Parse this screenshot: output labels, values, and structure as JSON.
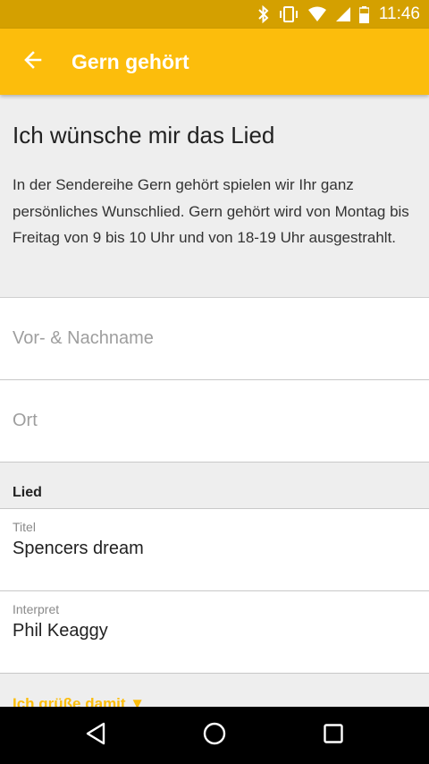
{
  "status_bar": {
    "time": "11:46",
    "icons": [
      "bluetooth-icon",
      "vibrate-icon",
      "wifi-icon",
      "signal-icon",
      "battery-icon"
    ]
  },
  "app_bar": {
    "title": "Gern gehört",
    "back_icon": "arrow-back-icon",
    "color": "#fcbd0c"
  },
  "intro": {
    "heading": "Ich wünsche mir das Lied",
    "description": "In der Sendereihe Gern gehört spielen wir Ihr ganz persönliches Wunschlied. Gern gehört wird von Montag bis Freitag von 9 bis 10 Uhr und von 18-19 Uhr ausgestrahlt."
  },
  "form": {
    "name_placeholder": "Vor- & Nachname",
    "city_placeholder": "Ort",
    "song_section": "Lied",
    "title_label": "Titel",
    "title_value": "Spencers dream",
    "artist_label": "Interpret",
    "artist_value": "Phil Keaggy",
    "greeting_label": "Ich grüße damit ▼"
  },
  "nav_bar": {
    "buttons": [
      "back-triangle-icon",
      "home-circle-icon",
      "recents-square-icon"
    ]
  }
}
